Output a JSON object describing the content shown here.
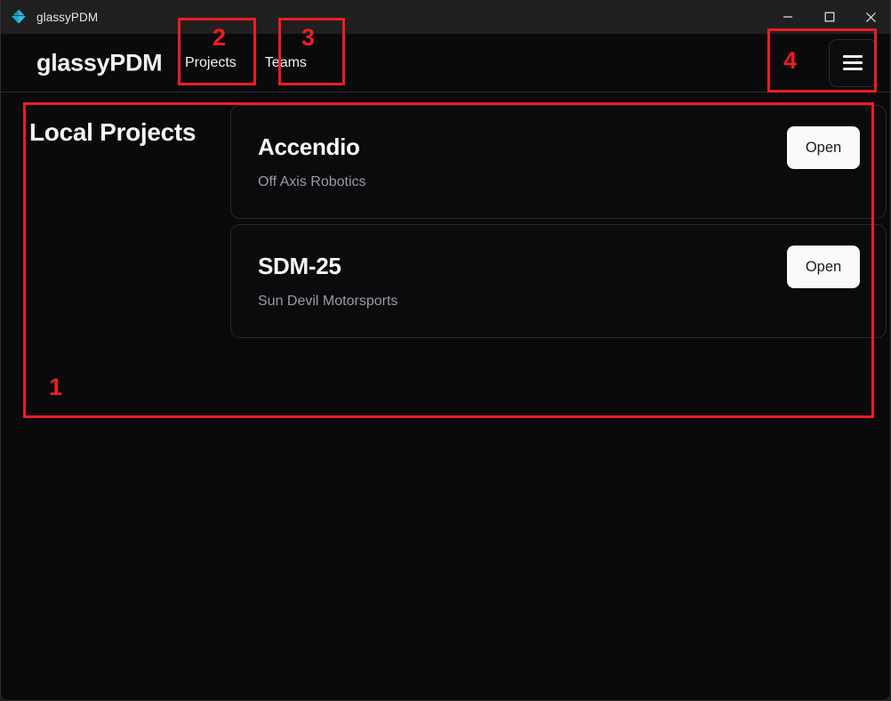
{
  "window": {
    "titlebar": {
      "app_icon": "gem-icon",
      "title": "glassyPDM",
      "controls": [
        {
          "name": "minimize",
          "icon": "minimize-icon"
        },
        {
          "name": "maximize",
          "icon": "maximize-icon"
        },
        {
          "name": "close",
          "icon": "close-icon"
        }
      ]
    }
  },
  "header": {
    "brand": "glassyPDM",
    "nav": [
      {
        "label": "Projects"
      },
      {
        "label": "Teams"
      }
    ],
    "menu_button_icon": "hamburger-icon"
  },
  "main": {
    "section_title": "Local Projects",
    "projects": [
      {
        "name": "Accendio",
        "team": "Off Axis Robotics",
        "action_label": "Open"
      },
      {
        "name": "SDM-25",
        "team": "Sun Devil Motorsports",
        "action_label": "Open"
      }
    ]
  },
  "annotations": {
    "color": "#ee1c23",
    "items": [
      {
        "id": "1",
        "label": "1",
        "target": "local-projects-panel"
      },
      {
        "id": "2",
        "label": "2",
        "target": "nav-projects"
      },
      {
        "id": "3",
        "label": "3",
        "target": "nav-teams"
      },
      {
        "id": "4",
        "label": "4",
        "target": "hamburger-menu-button"
      }
    ]
  },
  "colors": {
    "window_background": "#0a0a0c",
    "titlebar_background": "#202020",
    "card_border": "#2a2a2e",
    "accent_button_background": "#fafafa",
    "subtitle_text": "#9b9ba1",
    "annotation_red": "#ee1c23",
    "app_icon_cyan": "#29b6d8"
  }
}
